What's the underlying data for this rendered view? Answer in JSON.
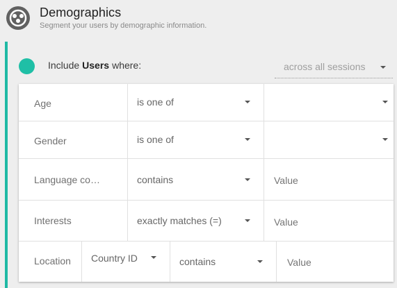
{
  "header": {
    "title": "Demographics",
    "subtitle": "Segment your users by demographic information."
  },
  "include": {
    "prefix": "Include",
    "subject": "Users",
    "suffix": "where:",
    "scope": "across all sessions"
  },
  "conditions": {
    "age": {
      "label": "Age",
      "operator": "is one of",
      "value": ""
    },
    "gender": {
      "label": "Gender",
      "operator": "is one of",
      "value": ""
    },
    "language": {
      "label": "Language co…",
      "operator": "contains",
      "placeholder": "Value"
    },
    "interests": {
      "label": "Interests",
      "operator": "exactly matches (=)",
      "placeholder": "Value"
    },
    "location": {
      "label": "Location",
      "dimension": "Country ID",
      "operator": "contains",
      "placeholder": "Value"
    }
  },
  "colors": {
    "accent": "#1fbfa6",
    "panel_border": "#1fb9a4",
    "icon": "#616161"
  }
}
